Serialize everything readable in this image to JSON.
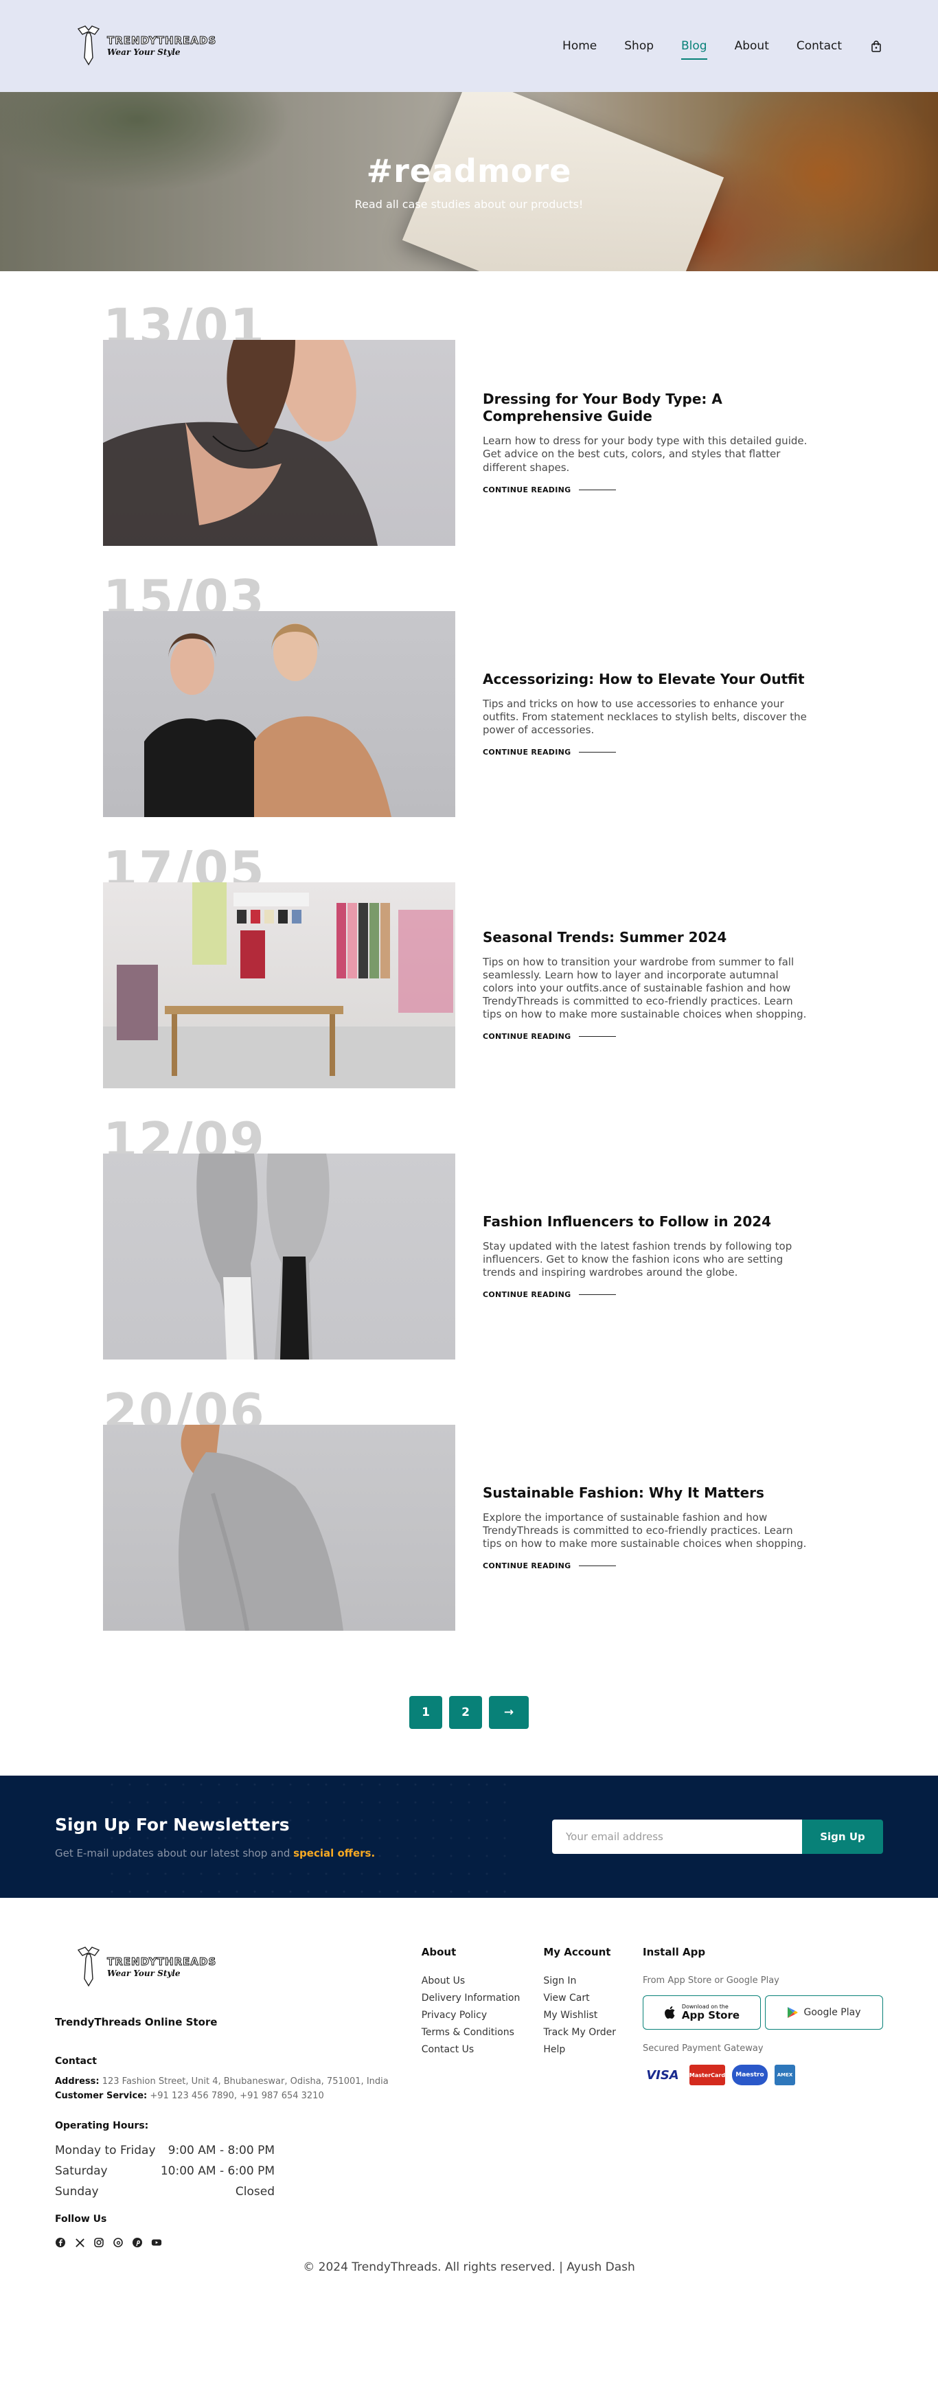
{
  "header": {
    "logo": {
      "name": "TRENDYTHREADS",
      "tagline": "Wear Your Style"
    },
    "nav": [
      {
        "label": "Home",
        "active": false
      },
      {
        "label": "Shop",
        "active": false
      },
      {
        "label": "Blog",
        "active": true
      },
      {
        "label": "About",
        "active": false
      },
      {
        "label": "Contact",
        "active": false
      }
    ],
    "cart_icon": "shopping-bag-icon"
  },
  "hero": {
    "title": "#readmore",
    "subtitle": "Read all case studies about our products!"
  },
  "posts": [
    {
      "date": "13/01",
      "title": "Dressing for Your Body Type: A Comprehensive Guide",
      "description": "Learn how to dress for your body type with this detailed guide. Get advice on the best cuts, colors, and styles that flatter different shapes.",
      "link": "CONTINUE READING"
    },
    {
      "date": "15/03",
      "title": "Accessorizing: How to Elevate Your Outfit",
      "description": "Tips and tricks on how to use accessories to enhance your outfits. From statement necklaces to stylish belts, discover the power of accessories.",
      "link": "CONTINUE READING"
    },
    {
      "date": "17/05",
      "title": "Seasonal Trends: Summer 2024",
      "description": "Tips on how to transition your wardrobe from summer to fall seamlessly. Learn how to layer and incorporate autumnal colors into your outfits.ance of sustainable fashion and how TrendyThreads is committed to eco-friendly practices. Learn tips on how to make more sustainable choices when shopping.",
      "link": "CONTINUE READING"
    },
    {
      "date": "12/09",
      "title": "Fashion Influencers to Follow in 2024",
      "description": "Stay updated with the latest fashion trends by following top influencers. Get to know the fashion icons who are setting trends and inspiring wardrobes around the globe.",
      "link": "CONTINUE READING"
    },
    {
      "date": "20/06",
      "title": "Sustainable Fashion: Why It Matters",
      "description": "Explore the importance of sustainable fashion and how TrendyThreads is committed to eco-friendly practices. Learn tips on how to make more sustainable choices when shopping.",
      "link": "CONTINUE READING"
    }
  ],
  "pagination": {
    "pages": [
      "1",
      "2"
    ],
    "next": "→"
  },
  "newsletter": {
    "title": "Sign Up For Newsletters",
    "subtitle_prefix": "Get E-mail updates about our latest shop and",
    "subtitle_highlight": "special offers.",
    "input_placeholder": "Your email address",
    "button": "Sign Up"
  },
  "footer": {
    "store_name": "TrendyThreads Online Store",
    "contact_heading": "Contact",
    "address_label": "Address:",
    "address": "123 Fashion Street, Unit 4, Bhubaneswar, Odisha, 751001, India",
    "service_label": "Customer Service:",
    "service": "+91 123 456 7890, +91 987 654 3210",
    "hours_heading": "Operating Hours:",
    "hours": [
      {
        "day": "Monday to Friday",
        "time": "9:00 AM - 8:00 PM"
      },
      {
        "day": "Saturday",
        "time": "10:00 AM - 6:00 PM"
      },
      {
        "day": "Sunday",
        "time": "Closed"
      }
    ],
    "follow_heading": "Follow Us",
    "about": {
      "heading": "About",
      "links": [
        "About Us",
        "Delivery Information",
        "Privacy Policy",
        "Terms & Conditions",
        "Contact Us"
      ]
    },
    "account": {
      "heading": "My Account",
      "links": [
        "Sign In",
        "View Cart",
        "My Wishlist",
        "Track My Order",
        "Help"
      ]
    },
    "install": {
      "heading": "Install App",
      "subtitle": "From App Store or Google Play",
      "appstore_small": "Download on the",
      "appstore": "App Store",
      "googleplay": "Google Play",
      "gateway": "Secured Payment Gateway",
      "cards": [
        "VISA",
        "MasterCard",
        "Maestro",
        "AMEX"
      ]
    },
    "copyright": "© 2024 TrendyThreads. All rights reserved. | Ayush Dash"
  },
  "colors": {
    "accent": "#088178",
    "header_bg": "#e3e6f3",
    "newsletter_bg": "#041e42",
    "highlight": "#f7a923"
  }
}
